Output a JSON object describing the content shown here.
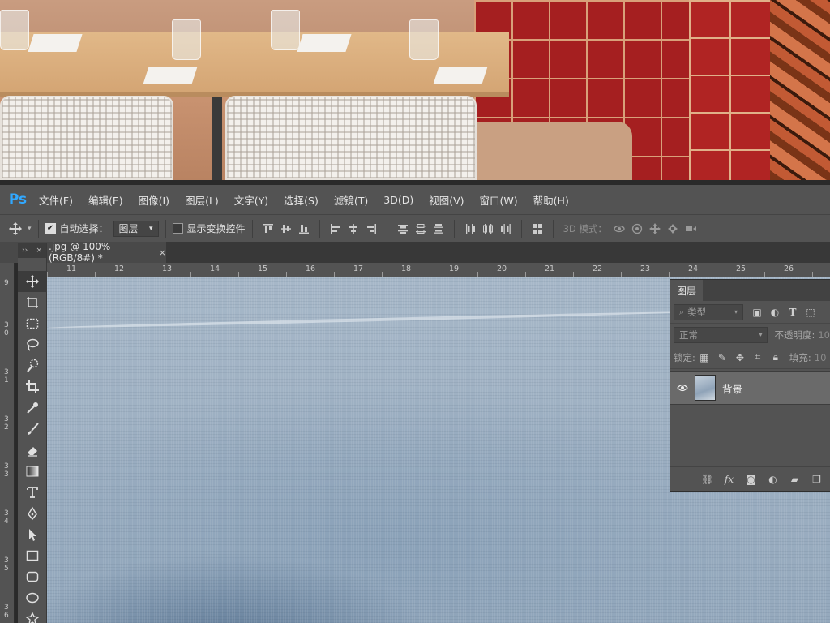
{
  "app": {
    "logo": "Ps"
  },
  "menu": [
    "文件(F)",
    "编辑(E)",
    "图像(I)",
    "图层(L)",
    "文字(Y)",
    "选择(S)",
    "滤镜(T)",
    "3D(D)",
    "视图(V)",
    "窗口(W)",
    "帮助(H)"
  ],
  "options": {
    "auto_select_label": "自动选择：",
    "auto_select_checked": true,
    "auto_select_target": "图层",
    "show_transform_label": "显示变换控件",
    "show_transform_checked": false,
    "mode3d_label": "3D 模式："
  },
  "document": {
    "tab_title": ".jpg @ 100%(RGB/8#) *",
    "close_glyph": "×"
  },
  "toolbox_header": {
    "collapse": "››",
    "close": "×"
  },
  "rulers": {
    "horizontal": [
      "11",
      "12",
      "13",
      "14",
      "15",
      "16",
      "17",
      "18",
      "19",
      "20",
      "21",
      "22",
      "23",
      "24",
      "25",
      "26"
    ],
    "vertical": [
      "9",
      "3 0",
      "3 1",
      "3 2",
      "3 3",
      "3 4",
      "3 5",
      "3 6"
    ]
  },
  "layers_panel": {
    "tab": "图层",
    "filter_kind": "类型",
    "blend_mode": "正常",
    "opacity_label": "不透明度:",
    "opacity_value": "10",
    "lock_label": "锁定:",
    "fill_label": "填充:",
    "fill_value": "10",
    "layer_name": "背景"
  },
  "colors": {
    "ps_blue": "#31a8ff",
    "ui_panel": "#535353",
    "ui_dark": "#383838"
  }
}
